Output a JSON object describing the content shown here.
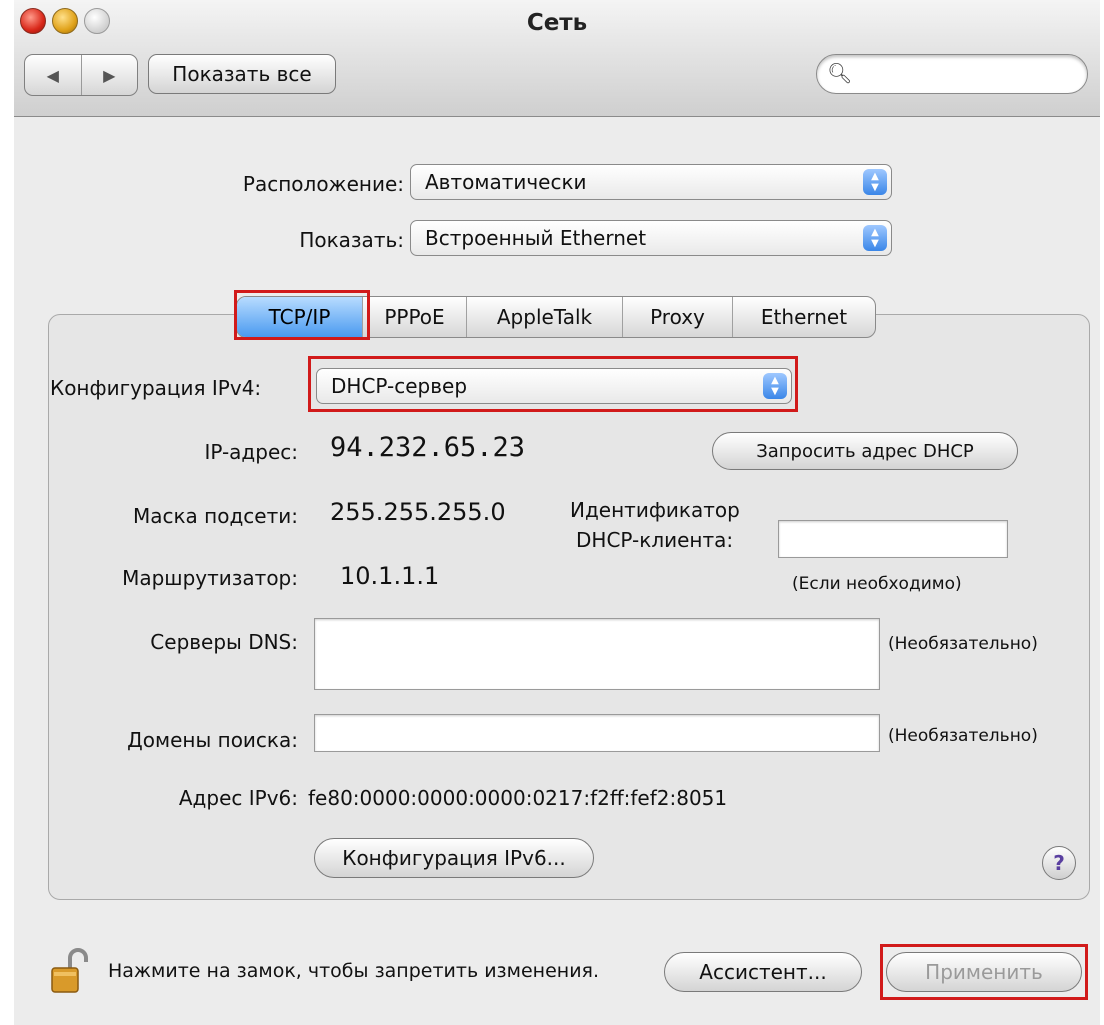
{
  "window": {
    "title": "Сеть"
  },
  "toolbar": {
    "back_glyph": "◀",
    "forward_glyph": "▶",
    "show_all_label": "Показать все",
    "search_placeholder": "",
    "search_icon": "magnifier-icon"
  },
  "location": {
    "label": "Расположение:",
    "value": "Автоматически"
  },
  "show": {
    "label": "Показать:",
    "value": "Встроенный Ethernet"
  },
  "tabs": [
    {
      "label": "TCP/IP",
      "selected": true
    },
    {
      "label": "PPPoE",
      "selected": false
    },
    {
      "label": "AppleTalk",
      "selected": false
    },
    {
      "label": "Proxy",
      "selected": false
    },
    {
      "label": "Ethernet",
      "selected": false
    }
  ],
  "tcpip": {
    "ipv4_config_label": "Конфигурация IPv4:",
    "ipv4_config_value": "DHCP-сервер",
    "ip_label": "IP-адрес:",
    "ip_value": "94.232.65.23",
    "renew_button": "Запросить адрес DHCP",
    "mask_label": "Маска подсети:",
    "mask_value": "255.255.255.0",
    "dhcp_client_label_1": "Идентификатор",
    "dhcp_client_label_2": "DHCP-клиента:",
    "dhcp_client_value": "",
    "dhcp_client_hint": "(Если необходимо)",
    "router_label": "Маршрутизатор:",
    "router_value": "10.1.1.1",
    "dns_label": "Серверы DNS:",
    "dns_value": "",
    "dns_hint": "(Необязательно)",
    "search_domains_label": "Домены поиска:",
    "search_domains_value": "",
    "search_domains_hint": "(Необязательно)",
    "ipv6_label": "Адрес IPv6:",
    "ipv6_value": "fe80:0000:0000:0000:0217:f2ff:fef2:8051",
    "ipv6_config_button": "Конфигурация IPv6...",
    "help_glyph": "?"
  },
  "footer": {
    "lock_text": "Нажмите на замок, чтобы запретить изменения.",
    "assistant_button": "Ассистент...",
    "apply_button": "Применить"
  },
  "colors": {
    "highlight": "#d11a1a",
    "accent": "#3a86e8"
  }
}
